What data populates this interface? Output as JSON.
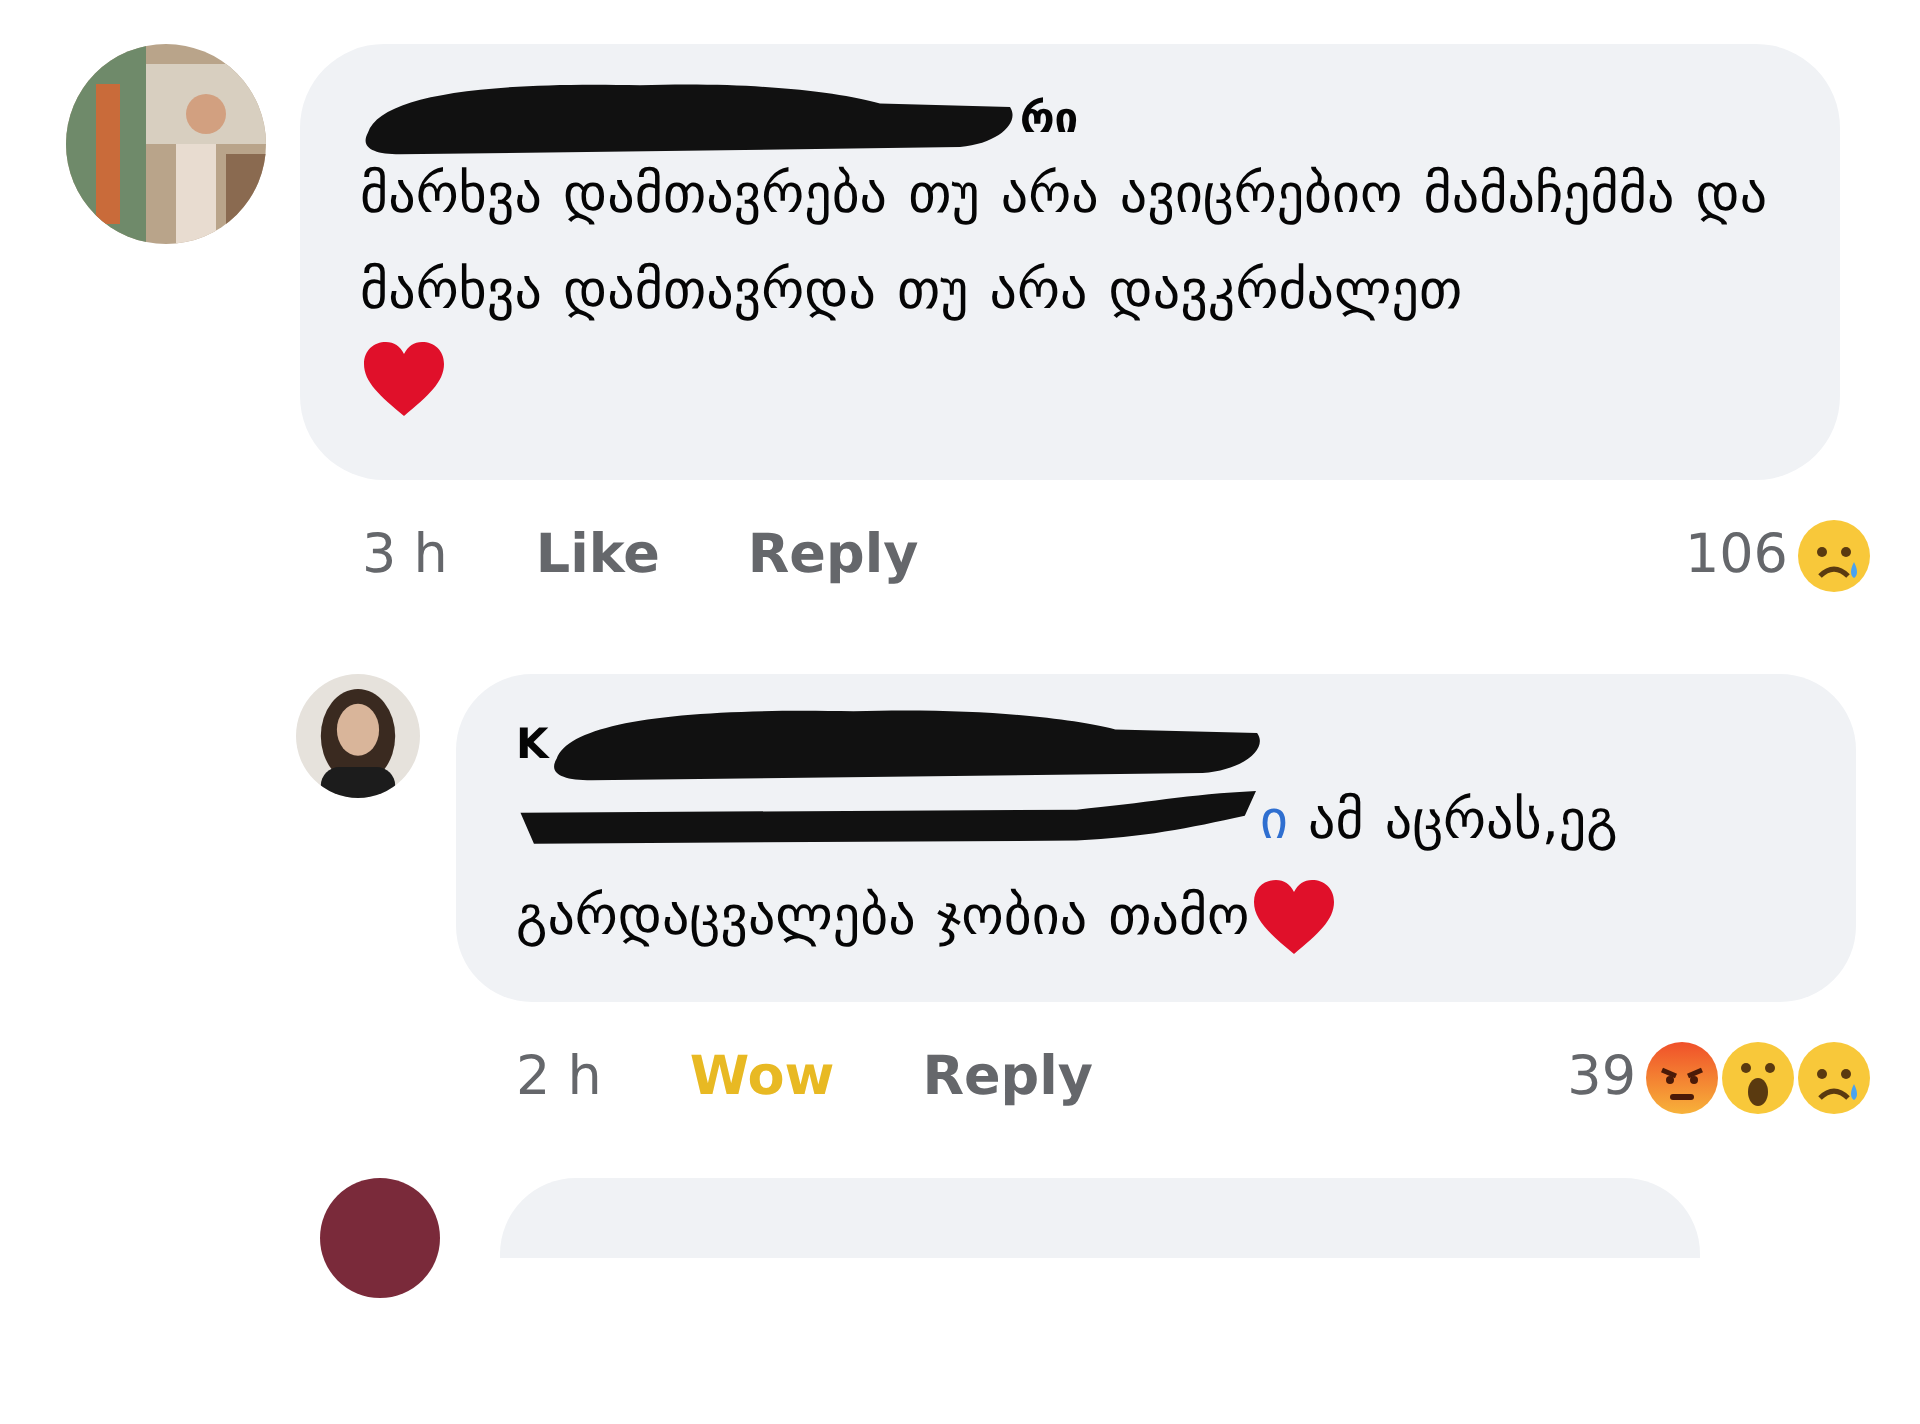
{
  "comments": [
    {
      "author_visible": "რი",
      "text": "მარხვა დამთავრება თუ არა ავიცრებიო მამაჩემმა და მარხვა დამთავრდა თუ არა დავკრძალეთ",
      "heart": true,
      "time": "3 h",
      "like": {
        "label": "Like",
        "reacted": false
      },
      "reply": "Reply",
      "count": "106",
      "reactions": [
        {
          "kind": "sad"
        }
      ]
    }
  ],
  "reply": {
    "author_visible": "K",
    "mention_tail": "ი",
    "lines": [
      "ამ აცრას,ეგ",
      "გარდაცვალება ჯობია თამო"
    ],
    "heart": true,
    "time": "2 h",
    "like": {
      "label": "Wow",
      "reacted": true
    },
    "reply": "Reply",
    "count": "39",
    "reactions": [
      {
        "kind": "angry"
      },
      {
        "kind": "wow"
      },
      {
        "kind": "sad"
      }
    ]
  }
}
